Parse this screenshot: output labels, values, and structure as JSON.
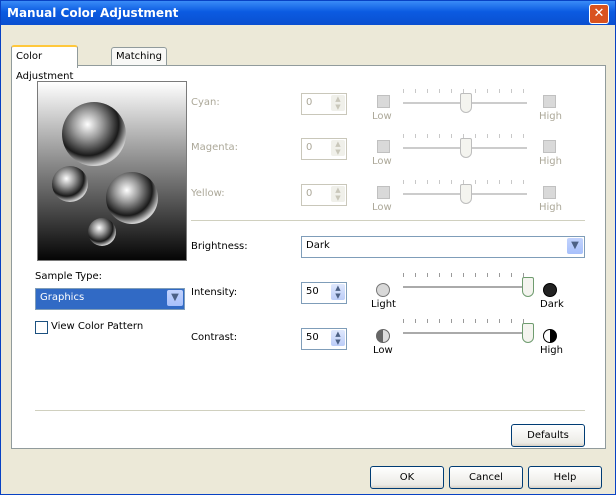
{
  "window": {
    "title": "Manual Color Adjustment",
    "close_glyph": "✕"
  },
  "tabs": [
    {
      "label": "Color Adjustment",
      "active": true
    },
    {
      "label": "Matching",
      "active": false
    }
  ],
  "preview": {
    "alt": "bubbles sample image"
  },
  "sample_type": {
    "label": "Sample Type:",
    "value": "Graphics"
  },
  "view_color_pattern": {
    "label": "View Color Pattern",
    "checked": false
  },
  "color_balance": [
    {
      "name": "Cyan:",
      "value": "0",
      "low": "Low",
      "high": "High",
      "level": 0.5,
      "enabled": false
    },
    {
      "name": "Magenta:",
      "value": "0",
      "low": "Low",
      "high": "High",
      "level": 0.5,
      "enabled": false
    },
    {
      "name": "Yellow:",
      "value": "0",
      "low": "Low",
      "high": "High",
      "level": 0.5,
      "enabled": false
    }
  ],
  "brightness": {
    "label": "Brightness:",
    "value": "Dark"
  },
  "intensity": {
    "label": "Intensity:",
    "value": "50",
    "low": "Light",
    "high": "Dark",
    "level": 1.0
  },
  "contrast": {
    "label": "Contrast:",
    "value": "50",
    "low": "Low",
    "high": "High",
    "level": 1.0
  },
  "buttons": {
    "defaults": "Defaults",
    "ok": "OK",
    "cancel": "Cancel",
    "help": "Help"
  },
  "colors": {
    "title_bar": "#0a58e0",
    "dialog_bg": "#ece9d8",
    "accent": "#316ac5"
  }
}
